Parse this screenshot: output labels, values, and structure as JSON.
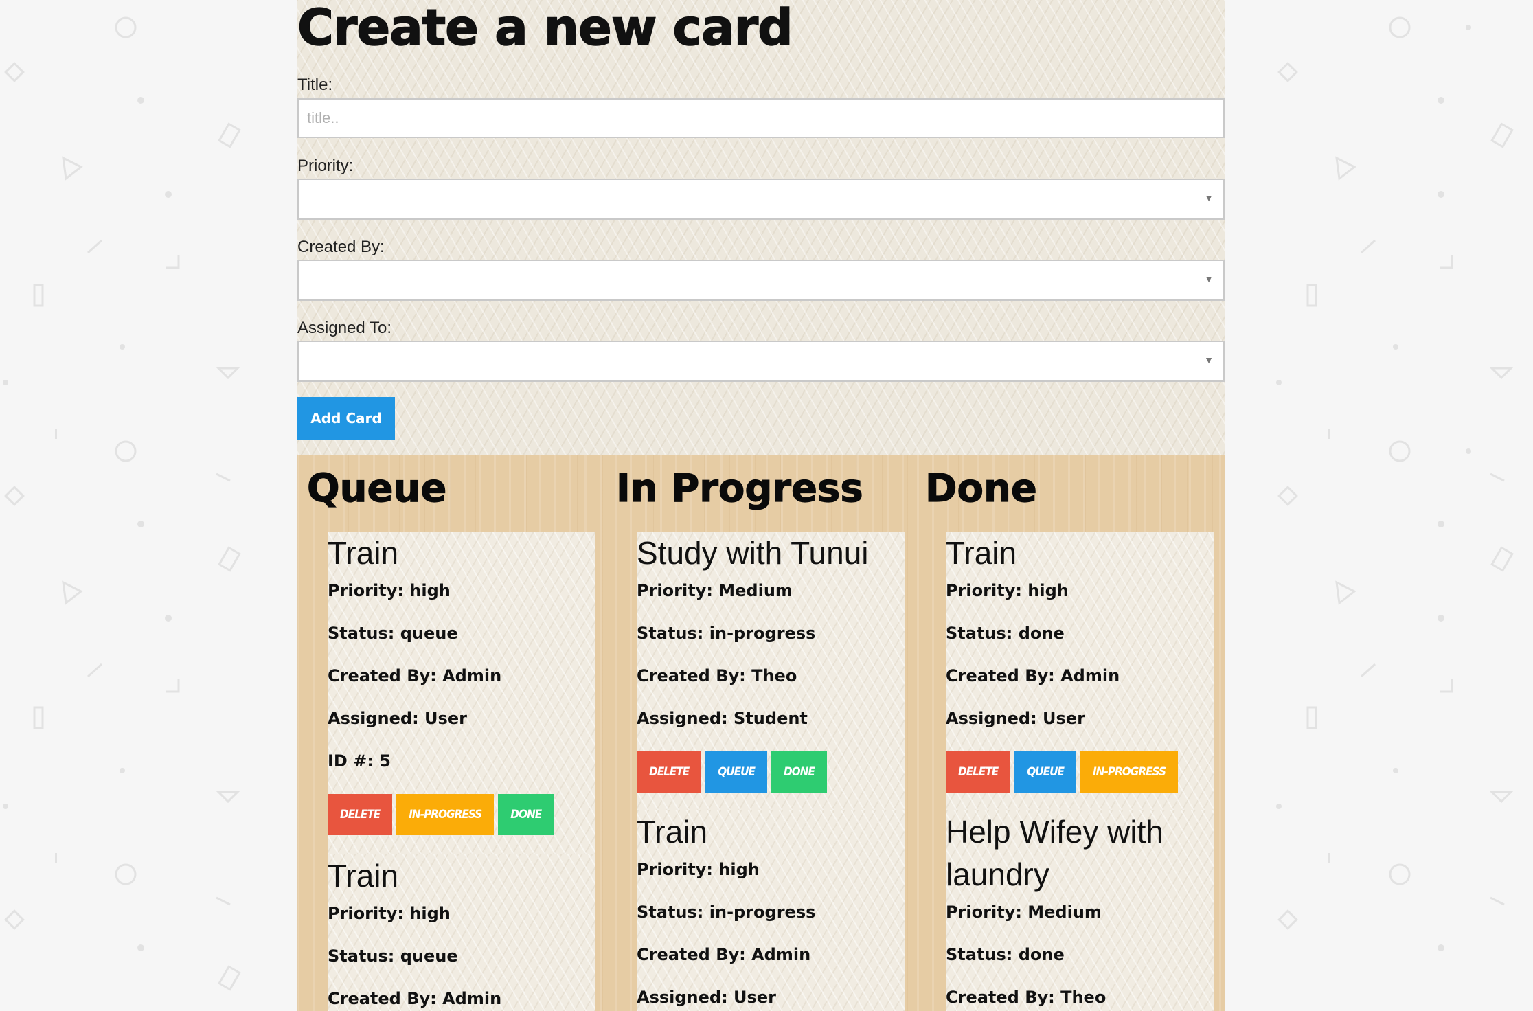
{
  "form": {
    "heading": "Create a new card",
    "title_label": "Title:",
    "title_placeholder": "title..",
    "title_value": "",
    "priority_label": "Priority:",
    "priority_value": "",
    "created_by_label": "Created By:",
    "created_by_value": "",
    "assigned_to_label": "Assigned To:",
    "assigned_to_value": "",
    "submit_label": "Add Card"
  },
  "board": {
    "columns": [
      {
        "title": "Queue",
        "cards": [
          {
            "title": "Train",
            "priority": "Priority: high",
            "status": "Status: queue",
            "created_by": "Created By: Admin",
            "assigned": "Assigned: User",
            "id": "ID #: 5",
            "actions": [
              "DELETE",
              "IN-PROGRESS",
              "DONE"
            ]
          },
          {
            "title": "Train",
            "priority": "Priority: high",
            "status": "Status: queue",
            "created_by": "Created By: Admin"
          }
        ]
      },
      {
        "title": "In Progress",
        "cards": [
          {
            "title": "Study with Tunui",
            "priority": "Priority: Medium",
            "status": "Status: in-progress",
            "created_by": "Created By: Theo",
            "assigned": "Assigned: Student",
            "actions": [
              "DELETE",
              "QUEUE",
              "DONE"
            ]
          },
          {
            "title": "Train",
            "priority": "Priority: high",
            "status": "Status: in-progress",
            "created_by": "Created By: Admin",
            "assigned": "Assigned: User"
          }
        ]
      },
      {
        "title": "Done",
        "cards": [
          {
            "title": "Train",
            "priority": "Priority: high",
            "status": "Status: done",
            "created_by": "Created By: Admin",
            "assigned": "Assigned: User",
            "actions": [
              "DELETE",
              "QUEUE",
              "IN-PROGRESS"
            ]
          },
          {
            "title": "Help Wifey with laundry",
            "priority": "Priority: Medium",
            "status": "Status: done",
            "created_by": "Created By: Theo"
          }
        ]
      }
    ]
  },
  "colors": {
    "delete": "#e8553e",
    "queue": "#2196e3",
    "in_progress": "#fbac08",
    "done": "#2ecc71",
    "add_button": "#2196e3"
  }
}
